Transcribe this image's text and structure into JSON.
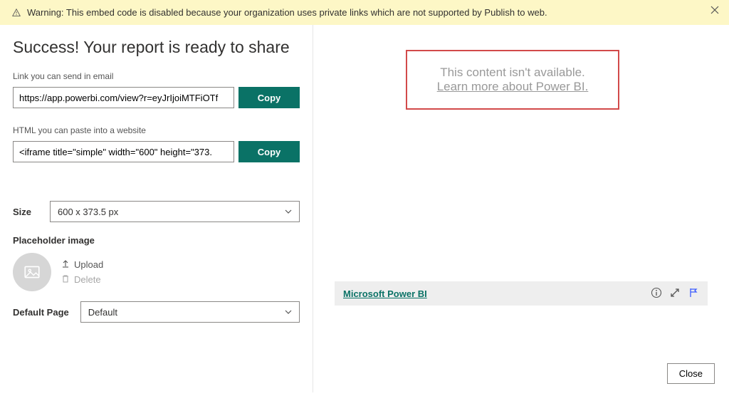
{
  "banner": {
    "text": "Warning: This embed code is disabled because your organization uses private links which are not supported by Publish to web."
  },
  "title": "Success! Your report is ready to share",
  "link_field": {
    "label": "Link you can send in email",
    "value": "https://app.powerbi.com/view?r=eyJrIjoiMTFiOTf",
    "button": "Copy"
  },
  "html_field": {
    "label": "HTML you can paste into a website",
    "value": "<iframe title=\"simple\" width=\"600\" height=\"373.",
    "button": "Copy"
  },
  "size": {
    "label": "Size",
    "value": "600 x 373.5 px"
  },
  "placeholder": {
    "label": "Placeholder image",
    "upload": "Upload",
    "del": "Delete"
  },
  "default_page": {
    "label": "Default Page",
    "value": "Default"
  },
  "preview": {
    "line1": "This content isn't available.",
    "line2": "Learn more about Power BI."
  },
  "footer": {
    "brand": "Microsoft Power BI"
  },
  "close": "Close"
}
